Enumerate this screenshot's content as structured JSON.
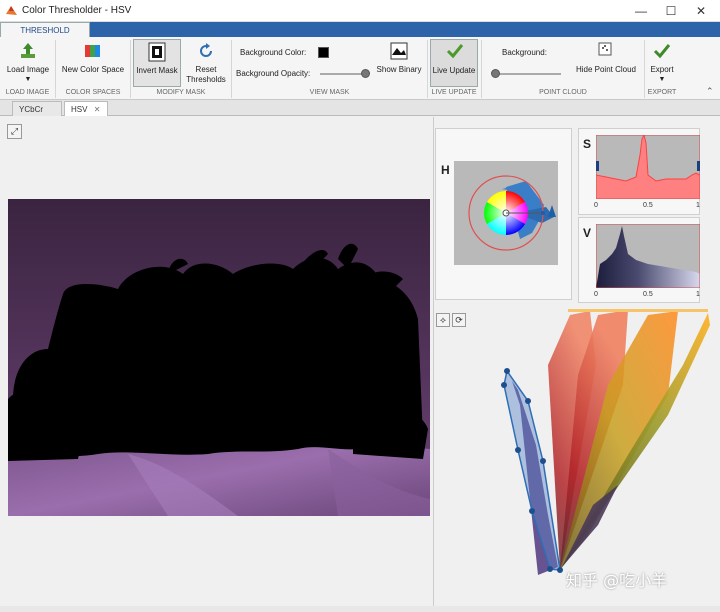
{
  "window": {
    "title": "Color Thresholder - HSV",
    "controls": {
      "minimize": "—",
      "maximize": "☐",
      "close": "✕"
    }
  },
  "ribbon": {
    "tab": "THRESHOLD",
    "buttons": {
      "load_image": "Load Image",
      "new_color_space": "New Color Space",
      "invert_mask": "Invert Mask",
      "reset_thresholds": "Reset Thresholds",
      "background_color": "Background Color:",
      "background_opacity": "Background Opacity:",
      "show_binary": "Show Binary",
      "live_update": "Live Update",
      "background": "Background:",
      "hide_point_cloud": "Hide Point Cloud",
      "export": "Export"
    },
    "groups": {
      "load_image": "LOAD IMAGE",
      "color_spaces": "COLOR SPACES",
      "modify_mask": "MODIFY MASK",
      "view_mask": "VIEW MASK",
      "live_update": "LIVE UPDATE",
      "point_cloud": "POINT CLOUD",
      "export": "EXPORT"
    },
    "background_opacity_level": 1.0,
    "point_cloud_background_level": 0.0
  },
  "doc_tabs": [
    {
      "label": "YCbCr",
      "active": false
    },
    {
      "label": "HSV",
      "active": true
    }
  ],
  "channels": {
    "h": {
      "label": "H"
    },
    "s": {
      "label": "S",
      "ticks": [
        "0",
        "0.5",
        "1"
      ]
    },
    "v": {
      "label": "V",
      "ticks": [
        "0",
        "0.5",
        "1"
      ]
    }
  },
  "watermark": "知乎 @吃小羊",
  "colors": {
    "ribbon_blue": "#2d63a8",
    "selection_blue": "#2e6eb5",
    "histogram_red": "#ff4040"
  }
}
